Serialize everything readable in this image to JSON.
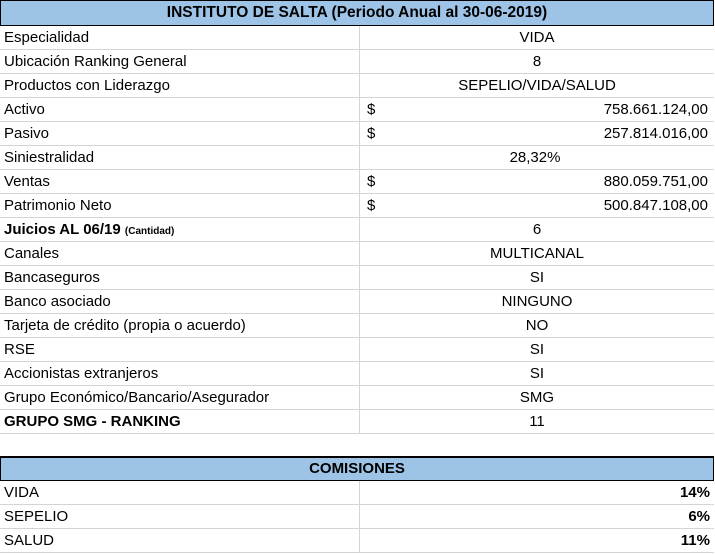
{
  "title": "INSTITUTO DE SALTA (Periodo Anual al 30-06-2019)",
  "rows": [
    {
      "label": "Especialidad",
      "value": "VIDA"
    },
    {
      "label": "Ubicación Ranking General",
      "value": "8"
    },
    {
      "label": "Productos con Liderazgo",
      "value": "SEPELIO/VIDA/SALUD"
    },
    {
      "label": "Activo",
      "currency": "$",
      "value": "758.661.124,00"
    },
    {
      "label": "Pasivo",
      "currency": "$",
      "value": "257.814.016,00"
    },
    {
      "label": "Siniestralidad",
      "value": "28,32%"
    },
    {
      "label": "Ventas",
      "currency": "$",
      "value": "880.059.751,00"
    },
    {
      "label": "Patrimonio Neto",
      "currency": "$",
      "value": "500.847.108,00"
    },
    {
      "label": "Juicios AL 06/19",
      "label_suffix": "(Cantidad)",
      "value": "6"
    },
    {
      "label": "Canales",
      "value": "MULTICANAL"
    },
    {
      "label": "Bancaseguros",
      "value": "SI"
    },
    {
      "label": "Banco asociado",
      "value": "NINGUNO"
    },
    {
      "label": "Tarjeta de crédito (propia o acuerdo)",
      "value": "NO"
    },
    {
      "label": "RSE",
      "value": "SI"
    },
    {
      "label": "Accionistas extranjeros",
      "value": "SI"
    },
    {
      "label": "Grupo Económico/Bancario/Asegurador",
      "value": "SMG"
    },
    {
      "label": "GRUPO SMG - RANKING",
      "value": "11"
    }
  ],
  "comisiones": {
    "title": "COMISIONES",
    "rows": [
      {
        "label": "VIDA",
        "value": "14%"
      },
      {
        "label": "SEPELIO",
        "value": "6%"
      },
      {
        "label": "SALUD",
        "value": "11%"
      }
    ]
  }
}
